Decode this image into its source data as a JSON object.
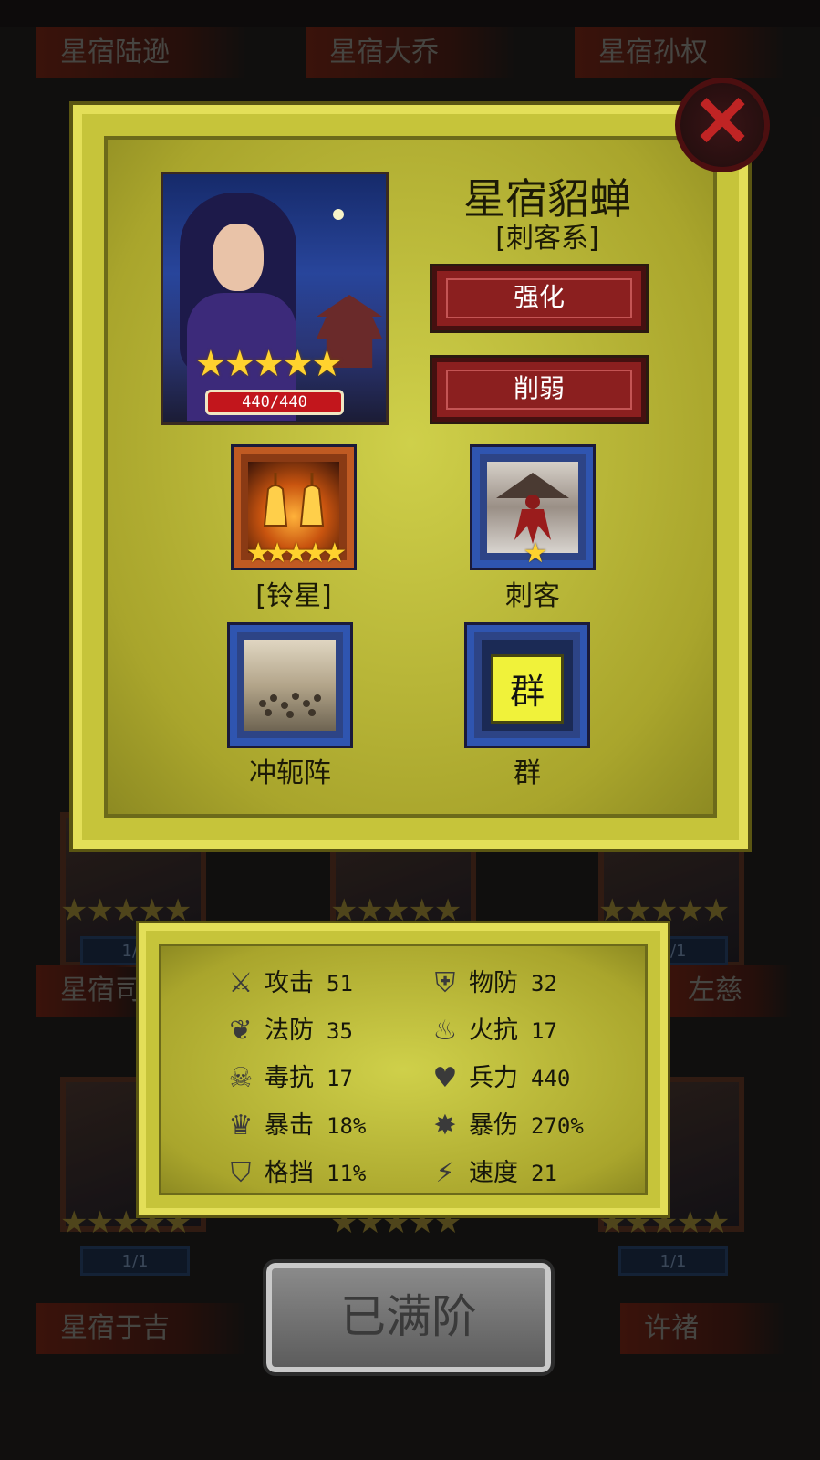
{
  "background": {
    "top_names": [
      "星宿陆逊",
      "星宿大乔",
      "星宿孙权"
    ],
    "mid_names": [
      "星宿司",
      "左慈"
    ],
    "bottom_names": [
      "星宿于吉",
      "许褚"
    ],
    "counts": [
      "1/1",
      "1/1",
      "1/1",
      "1/1",
      "1/1"
    ]
  },
  "hero": {
    "name": "星宿貂蝉",
    "class": "[刺客系]",
    "stars": "★★★★★",
    "hp": "440/440"
  },
  "buttons": {
    "enhance": "强化",
    "weaken": "削弱",
    "max_level": "已满阶",
    "close_icon": "close-x-icon"
  },
  "skills": [
    {
      "label": "[铃星]",
      "stars": "★★★★★",
      "icon": "bells-icon",
      "frame": "orange"
    },
    {
      "label": "刺客",
      "stars": "★",
      "icon": "assassin-icon",
      "frame": "blue"
    },
    {
      "label": "冲轭阵",
      "stars": "",
      "icon": "formation-icon",
      "frame": "blue"
    },
    {
      "label": "群",
      "stars": "",
      "icon": "faction-banner-icon",
      "frame": "blue",
      "banner_text": "群"
    }
  ],
  "stats": [
    {
      "label": "攻击",
      "value": "51",
      "icon": "crossed-swords-icon"
    },
    {
      "label": "物防",
      "value": "32",
      "icon": "shield-icon"
    },
    {
      "label": "法防",
      "value": "35",
      "icon": "leaf-icon"
    },
    {
      "label": "火抗",
      "value": "17",
      "icon": "flame-icon"
    },
    {
      "label": "毒抗",
      "value": "17",
      "icon": "skull-icon"
    },
    {
      "label": "兵力",
      "value": "440",
      "icon": "heart-icon"
    },
    {
      "label": "暴击",
      "value": "18%",
      "icon": "claw-icon"
    },
    {
      "label": "暴伤",
      "value": "270%",
      "icon": "burst-icon"
    },
    {
      "label": "格挡",
      "value": "11%",
      "icon": "block-shield-icon"
    },
    {
      "label": "速度",
      "value": "21",
      "icon": "lightning-icon"
    }
  ]
}
